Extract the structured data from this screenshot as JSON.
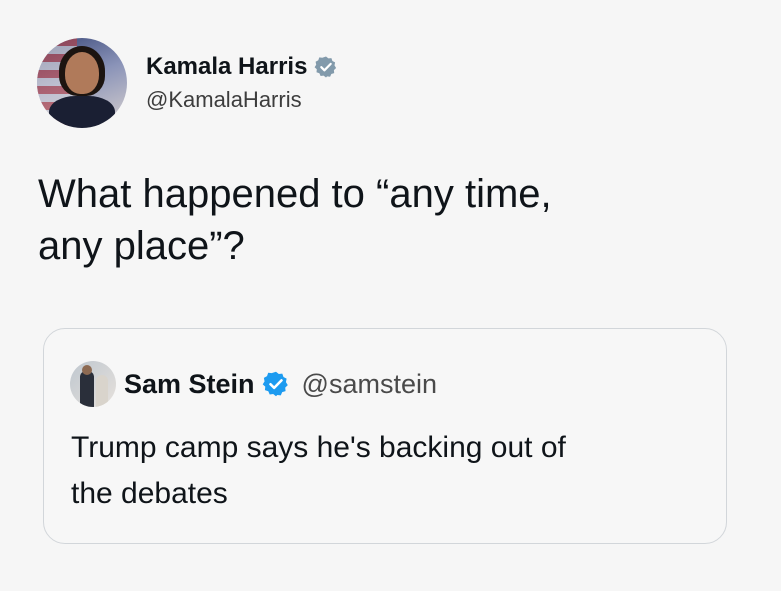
{
  "tweet": {
    "author": {
      "display_name": "Kamala Harris",
      "handle": "@KamalaHarris",
      "verified_icon": "verified-badge-icon"
    },
    "text_line1": "What happened to “any time,",
    "text_line2": "any place”?"
  },
  "quoted_tweet": {
    "author": {
      "display_name": "Sam Stein",
      "handle": "@samstein",
      "verified_icon": "verified-badge-icon"
    },
    "text_line1": "Trump camp says he's backing out of",
    "text_line2": "the debates"
  },
  "colors": {
    "verified_blue": "#1d9bf0",
    "verified_grey": "#829aab",
    "background": "#f6f6f6",
    "quote_border": "#d2d6da"
  }
}
